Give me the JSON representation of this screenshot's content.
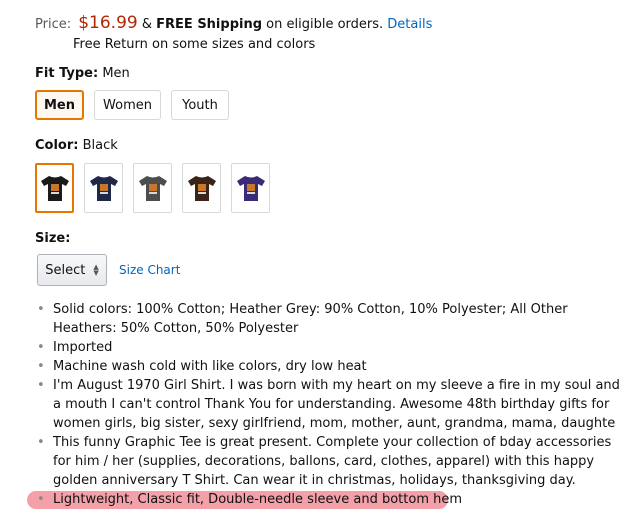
{
  "price": {
    "label": "Price:",
    "amount": "$16.99",
    "amp": "&",
    "free_shipping": "FREE Shipping",
    "eligible": "on eligible orders.",
    "details_link": "Details",
    "free_return": "Free Return on some sizes and colors"
  },
  "fit_type": {
    "label": "Fit Type:",
    "selected": "Men",
    "options": [
      "Men",
      "Women",
      "Youth"
    ]
  },
  "color": {
    "label": "Color:",
    "selected": "Black",
    "swatches": [
      {
        "name": "black",
        "color": "#1a1a1a"
      },
      {
        "name": "navy",
        "color": "#1f2947"
      },
      {
        "name": "grey",
        "color": "#4d4d4d"
      },
      {
        "name": "brown",
        "color": "#3b2417"
      },
      {
        "name": "purple",
        "color": "#3b2a78"
      }
    ]
  },
  "size": {
    "label": "Size:",
    "select_label": "Select",
    "size_chart_link": "Size Chart"
  },
  "bullets": [
    "Solid colors: 100% Cotton; Heather Grey: 90% Cotton, 10% Polyester; All Other Heathers: 50% Cotton, 50% Polyester",
    "Imported",
    "Machine wash cold with like colors, dry low heat",
    "I'm August 1970 Girl Shirt. I was born with my heart on my sleeve a fire in my soul and a mouth I can't control Thank You for understanding. Awesome 48th birthday gifts for women girls, big sister, sexy girlfriend, mom, mother, aunt, grandma, mama, daughte",
    "This funny Graphic Tee is great present. Complete your collection of bday accessories for him / her (supplies, decorations, ballons, card, clothes, apparel) with this happy golden anniversary T Shirt. Can wear it in christmas, holidays, thanksgiving day.",
    "Lightweight, Classic fit, Double-needle sleeve and bottom hem"
  ],
  "colors": {
    "price_red": "#b12704",
    "link_blue": "#0066c0",
    "selected_orange": "#e77600",
    "highlight_pink": "#f4a0a8"
  }
}
